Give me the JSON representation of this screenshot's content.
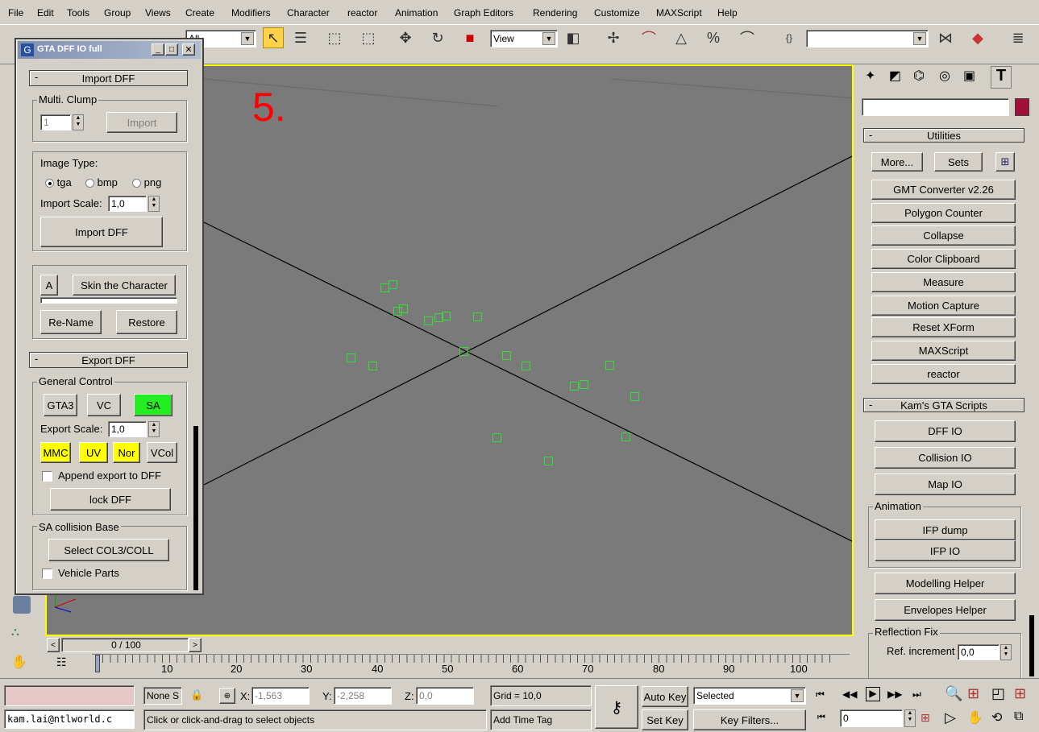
{
  "menu": [
    "File",
    "Edit",
    "Tools",
    "Group",
    "Views",
    "Create",
    "Modifiers",
    "Character",
    "reactor",
    "Animation",
    "Graph Editors",
    "Rendering",
    "Customize",
    "MAXScript",
    "Help"
  ],
  "toolbar": {
    "selection_filter": "All",
    "reference_coord": "View",
    "named_selection": ""
  },
  "viewport": {
    "step_label": "5.",
    "step_color": "#ff0000",
    "bg_color": "#7a7a7a",
    "border_color": "#ffff00",
    "helper_color": "#33dd33"
  },
  "floater": {
    "title": "GTA DFF IO full",
    "import_rollout": "Import DFF",
    "multi_clump_label": "Multi. Clump",
    "multi_clump_value": "1",
    "import_button": "Import",
    "image_type_label": "Image Type:",
    "image_types": [
      "tga",
      "bmp",
      "png"
    ],
    "image_type_selected": "tga",
    "import_scale_label": "Import Scale:",
    "import_scale_value": "1,0",
    "import_dff_button": "Import DFF",
    "a_button": "A",
    "skin_button": "Skin the Character",
    "rename_button": "Re-Name",
    "restore_button": "Restore",
    "export_rollout": "Export DFF",
    "general_control_label": "General Control",
    "gta3_button": "GTA3",
    "vc_button": "VC",
    "sa_button": "SA",
    "export_scale_label": "Export Scale:",
    "export_scale_value": "1,0",
    "mmc_button": "MMC",
    "uv_button": "UV",
    "nor_button": "Nor",
    "vcol_button": "VCol",
    "append_label": "Append export to DFF",
    "lock_button": "lock DFF",
    "sa_collision_label": "SA collision Base",
    "select_col_button": "Select COL3/COLL",
    "vehicle_parts_label": "Vehicle Parts"
  },
  "command_panel": {
    "utilities_rollout": "Utilities",
    "more_button": "More...",
    "sets_button": "Sets",
    "utilities": [
      "GMT Converter v2.26",
      "Polygon Counter",
      "Collapse",
      "Color Clipboard",
      "Measure",
      "Motion Capture",
      "Reset XForm",
      "MAXScript",
      "reactor"
    ],
    "kams_rollout": "Kam's GTA Scripts",
    "kams_buttons": [
      "DFF IO",
      "Collision IO",
      "Map IO"
    ],
    "animation_label": "Animation",
    "animation_buttons": [
      "IFP dump",
      "IFP IO"
    ],
    "helper_buttons": [
      "Modelling Helper",
      "Envelopes Helper"
    ],
    "reflection_label": "Reflection Fix",
    "ref_increment_label": "Ref. increment",
    "ref_increment_value": "0,0"
  },
  "timeline": {
    "slider_label": "0 / 100",
    "ticks": [
      "10",
      "20",
      "30",
      "40",
      "50",
      "60",
      "70",
      "80",
      "90",
      "100"
    ]
  },
  "status": {
    "selection_text": "None S",
    "x_label": "X:",
    "x_value": "-1,563",
    "y_label": "Y:",
    "y_value": "-2,258",
    "z_label": "Z:",
    "z_value": "0,0",
    "grid": "Grid = 10,0",
    "auto_key": "Auto Key",
    "set_key": "Set Key",
    "selected_dropdown": "Selected",
    "key_filters": "Key Filters...",
    "frame_value": "0",
    "prompt": "Click or click-and-drag to select objects",
    "add_time_tag": "Add Time Tag",
    "listener": "kam.lai@ntlworld.c"
  }
}
